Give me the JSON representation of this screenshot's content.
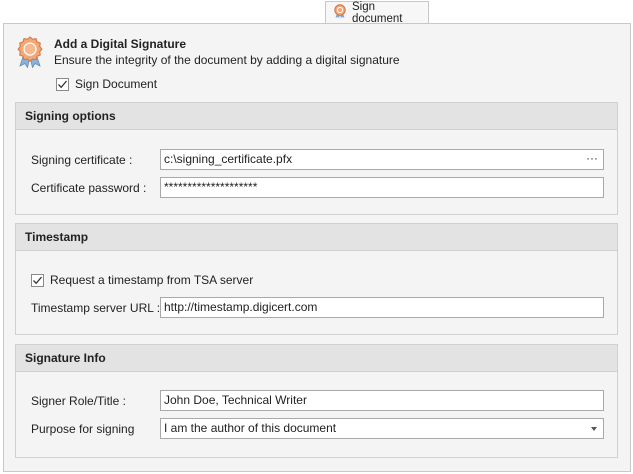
{
  "tab": {
    "label": "Sign document",
    "icon": "award-ribbon-icon"
  },
  "header": {
    "title": "Add a Digital Signature",
    "subtitle": "Ensure the integrity of the document by adding a digital signature",
    "sign_document_label": "Sign Document",
    "sign_document_checked": true
  },
  "signing_options": {
    "title": "Signing options",
    "certificate_label": "Signing certificate :",
    "certificate_value": "c:\\signing_certificate.pfx",
    "browse_label": "···",
    "password_label": "Certificate password :",
    "password_value": "********************"
  },
  "timestamp": {
    "title": "Timestamp",
    "request_label": "Request a timestamp from TSA server",
    "request_checked": true,
    "url_label": "Timestamp server URL :",
    "url_value": "http://timestamp.digicert.com"
  },
  "signature_info": {
    "title": "Signature Info",
    "role_label": "Signer Role/Title :",
    "role_value": "John Doe, Technical Writer",
    "purpose_label": "Purpose for signing",
    "purpose_value": "I am the author of this document"
  },
  "colors": {
    "accent": "#e8894b",
    "ribbon": "#7fa7cf"
  }
}
